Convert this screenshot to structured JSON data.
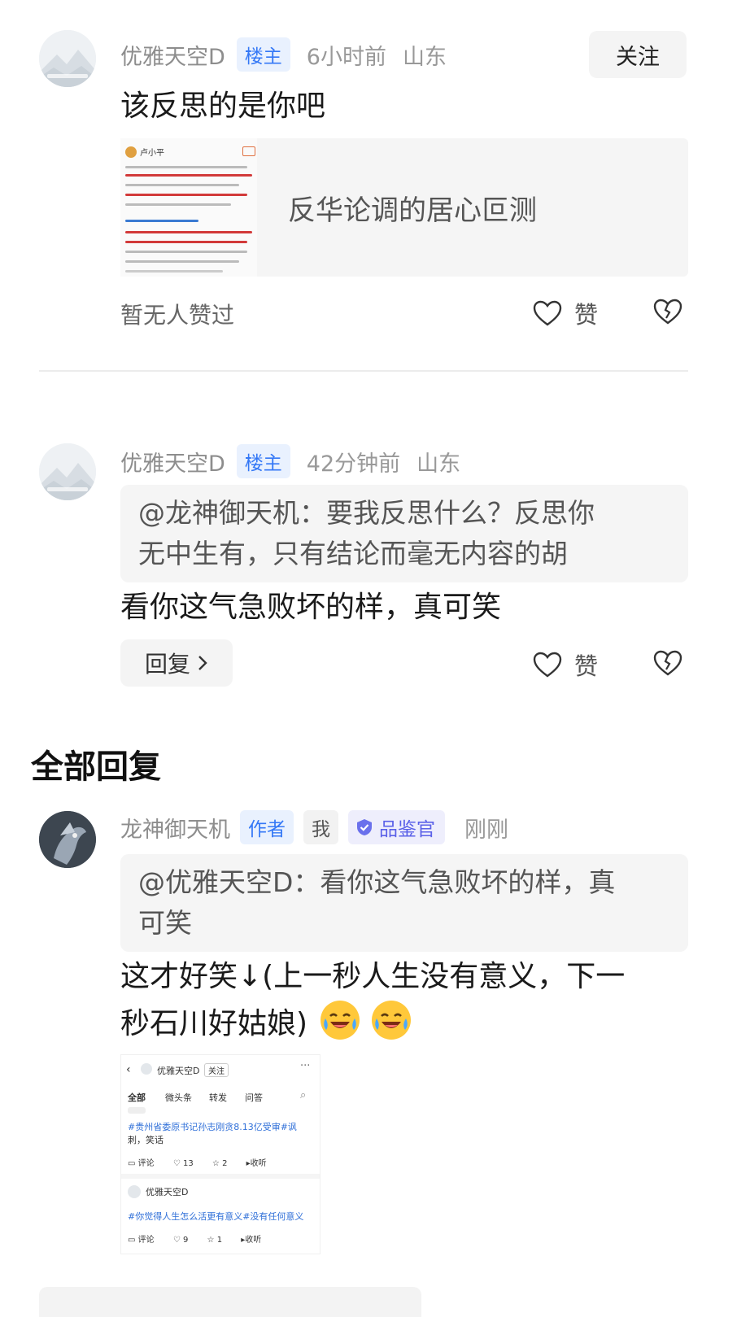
{
  "comment1": {
    "user": "优雅天空D",
    "badge": "楼主",
    "time": "6小时前",
    "location": "山东",
    "follow_label": "关注",
    "text": "该反思的是你吧",
    "link_card": {
      "title": "反华论调的居心叵测",
      "thumb_author": "卢小平"
    },
    "likes_text": "暂无人赞过",
    "like_label": "赞"
  },
  "comment2": {
    "user": "优雅天空D",
    "badge": "楼主",
    "time": "42分钟前",
    "location": "山东",
    "quote_line1": "@龙神御天机：要我反思什么？反思你",
    "quote_line2": "无中生有，只有结论而毫无内容的胡",
    "text": "看你这气急败坏的样，真可笑",
    "reply_label": "回复",
    "like_label": "赞"
  },
  "section_title": "全部回复",
  "reply": {
    "user": "龙神御天机",
    "badge_author": "作者",
    "badge_me": "我",
    "badge_reviewer": "品鉴官",
    "time": "刚刚",
    "quote_line1": "@优雅天空D：看你这气急败坏的样，真",
    "quote_line2": "可笑",
    "text_line1": "这才好笑↓(上一秒人生没有意义，下一",
    "text_line2": "秒石川好姑娘)",
    "screenshot": {
      "user": "优雅天空D",
      "follow": "关注",
      "tabs": [
        "全部",
        "微头条",
        "转发",
        "问答"
      ],
      "post1_text": "#贵州省委原书记孙志刚贪8.13亿受审#讽",
      "post1_text2": "刺，笑话",
      "post1_actions": [
        "评论",
        "13",
        "2",
        "收听"
      ],
      "post2_user": "优雅天空D",
      "post2_text": "#你觉得人生怎么活更有意义#没有任何意义",
      "post2_actions": [
        "评论",
        "9",
        "1",
        "收听"
      ]
    }
  },
  "colors": {
    "accent_blue": "#3478f6",
    "reviewer_purple": "#5b61e8",
    "emoji_yellow": "#ffc83a"
  }
}
